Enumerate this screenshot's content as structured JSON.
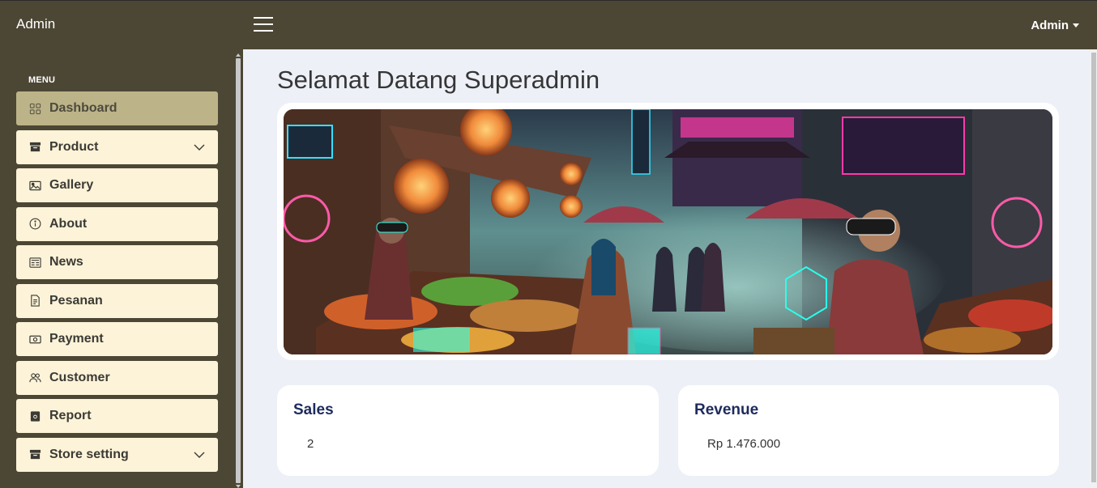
{
  "topbar": {
    "brand": "Admin",
    "user_menu_label": "Admin"
  },
  "sidebar": {
    "menu_title": "MENU",
    "items": [
      {
        "label": "Dashboard",
        "icon": "grid-icon",
        "active": true,
        "has_submenu": false
      },
      {
        "label": "Product",
        "icon": "archive-icon",
        "active": false,
        "has_submenu": true
      },
      {
        "label": "Gallery",
        "icon": "image-icon",
        "active": false,
        "has_submenu": false
      },
      {
        "label": "About",
        "icon": "info-icon",
        "active": false,
        "has_submenu": false
      },
      {
        "label": "News",
        "icon": "newspaper-icon",
        "active": false,
        "has_submenu": false
      },
      {
        "label": "Pesanan",
        "icon": "document-icon",
        "active": false,
        "has_submenu": false
      },
      {
        "label": "Payment",
        "icon": "cash-icon",
        "active": false,
        "has_submenu": false
      },
      {
        "label": "Customer",
        "icon": "people-icon",
        "active": false,
        "has_submenu": false
      },
      {
        "label": "Report",
        "icon": "report-icon",
        "active": false,
        "has_submenu": false
      },
      {
        "label": "Store setting",
        "icon": "archive-icon",
        "active": false,
        "has_submenu": true
      }
    ]
  },
  "main": {
    "page_title": "Selamat Datang Superadmin",
    "banner_alt": "market-banner",
    "sales": {
      "title": "Sales",
      "value": "2"
    },
    "revenue": {
      "title": "Revenue",
      "value": "Rp 1.476.000"
    }
  },
  "colors": {
    "topbar_bg": "#4c4634",
    "menu_item_bg": "#fdf3d8",
    "menu_active_bg": "#bcb388",
    "main_bg": "#edf1f7",
    "stat_title": "#1d2b5c"
  }
}
